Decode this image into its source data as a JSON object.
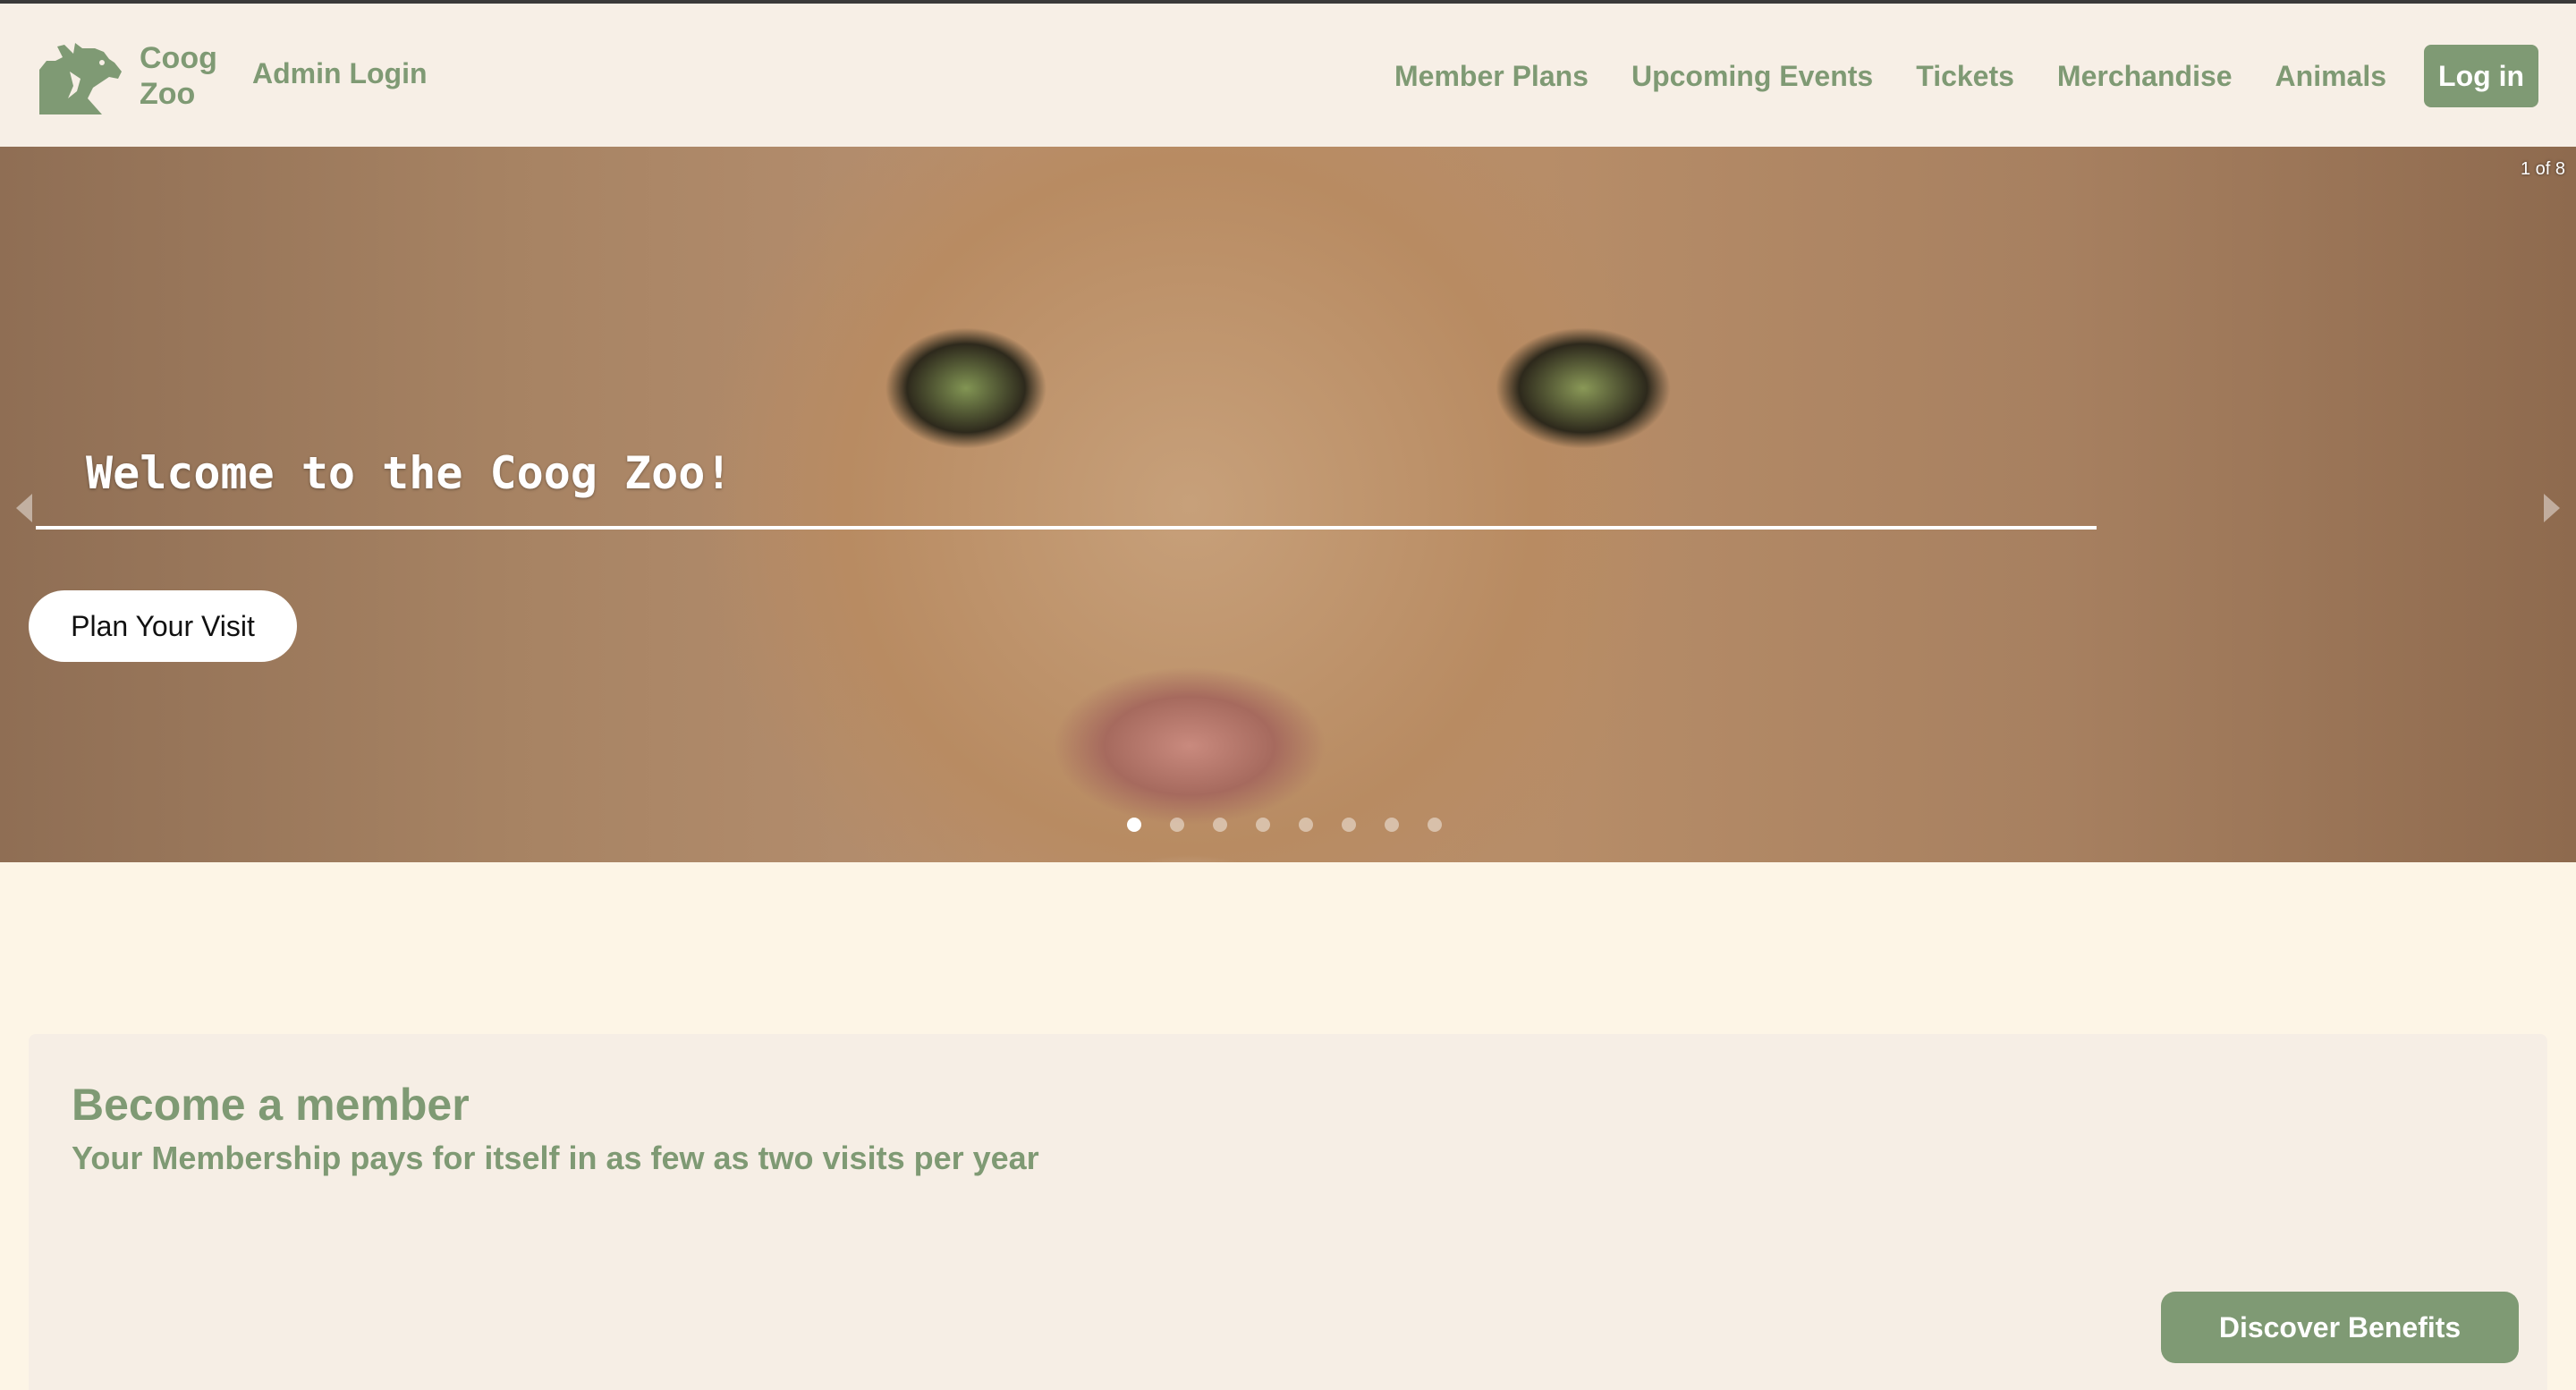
{
  "brand": {
    "line1": "Coog",
    "line2": "Zoo",
    "logo_icon": "cougar-logo-icon",
    "accent_color": "#7f9a74"
  },
  "header": {
    "admin_login": "Admin Login",
    "nav": [
      "Member Plans",
      "Upcoming Events",
      "Tickets",
      "Merchandise",
      "Animals"
    ],
    "login_label": "Log in"
  },
  "carousel": {
    "counter": "1 of 8",
    "title": "Welcome to the Coog Zoo!",
    "cta_label": "Plan Your Visit",
    "slide_count": 8,
    "active_index": 0,
    "prev_icon": "chevron-left-icon",
    "next_icon": "chevron-right-icon"
  },
  "membership": {
    "title": "Become a member",
    "subtitle": "Your Membership pays for itself in as few as two visits per year",
    "cta_label": "Discover Benefits"
  }
}
